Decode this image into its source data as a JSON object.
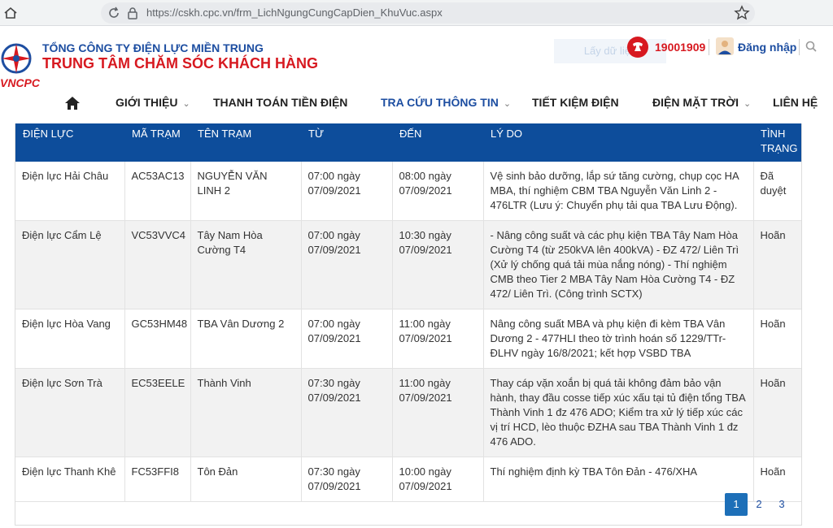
{
  "browser": {
    "url": "https://cskh.cpc.vn/frm_LichNgungCungCapDien_KhuVuc.aspx",
    "icons": [
      "home-icon",
      "reload-icon",
      "lock-icon",
      "star-icon"
    ]
  },
  "header": {
    "company": "TỔNG CÔNG TY ĐIỆN LỰC MIỀN TRUNG",
    "center": "TRUNG TÂM CHĂM SÓC KHÁCH HÀNG",
    "logo_text": "VNCPC",
    "faint_button": "Lấy dữ liệu",
    "hotline": "19001909",
    "login": "Đăng nhập",
    "colors": {
      "brand_blue": "#1d4ea1",
      "brand_red": "#d71920"
    }
  },
  "nav": {
    "items": [
      {
        "label": "GIỚI THIỆU",
        "has_dropdown": true
      },
      {
        "label": "THANH TOÁN TIỀN ĐIỆN",
        "has_dropdown": false
      },
      {
        "label": "TRA CỨU THÔNG TIN",
        "has_dropdown": true
      },
      {
        "label": "TIẾT KIỆM ĐIỆN",
        "has_dropdown": false
      },
      {
        "label": "ĐIỆN MẶT TRỜI",
        "has_dropdown": true
      },
      {
        "label": "LIÊN HỆ",
        "has_dropdown": false
      }
    ],
    "active_index": 2,
    "chevron": "⌄"
  },
  "table": {
    "header_color": "#0d4d9b",
    "columns": [
      "ĐIỆN LỰC",
      "MÃ TRẠM",
      "TÊN TRẠM",
      "TỪ",
      "ĐẾN",
      "LÝ DO",
      "TÌNH TRẠNG"
    ],
    "rows": [
      {
        "dien_luc": "Điện lực Hải Châu",
        "ma_tram": "AC53AC13",
        "ten_tram": "NGUYỄN VĂN LINH 2",
        "tu": "07:00 ngày 07/09/2021",
        "den": "08:00 ngày 07/09/2021",
        "ly_do": "Vệ sinh bảo dưỡng, lắp sứ tăng cường, chụp cọc HA MBA, thí nghiệm CBM TBA Nguyễn Văn Linh 2 - 476LTR (Lưu ý: Chuyển phụ tải qua TBA Lưu Động).",
        "tinh_trang": "Đã duyệt"
      },
      {
        "dien_luc": "Điện lực Cẩm Lệ",
        "ma_tram": "VC53VVC4",
        "ten_tram": "Tây Nam Hòa Cường T4",
        "tu": "07:00 ngày 07/09/2021",
        "den": "10:30 ngày 07/09/2021",
        "ly_do": "- Nâng công suất và các phụ kiện TBA Tây Nam Hòa Cường T4 (từ 250kVA lên 400kVA) - ĐZ 472/ Liên Trì (Xử lý chống quá tải mùa nắng nóng) - Thí nghiệm CMB theo Tier 2 MBA Tây Nam Hòa Cường T4 - ĐZ 472/ Liên Trì. (Công trình SCTX)",
        "tinh_trang": "Hoãn"
      },
      {
        "dien_luc": "Điện lực Hòa Vang",
        "ma_tram": "GC53HM48",
        "ten_tram": "TBA Vân Dương 2",
        "tu": "07:00 ngày 07/09/2021",
        "den": "11:00 ngày 07/09/2021",
        "ly_do": "Nâng công suất MBA và phụ kiện đi kèm TBA Vân Dương 2 - 477HLI theo tờ trình hoán số 1229/TTr-ĐLHV ngày 16/8/2021; kết hợp VSBD TBA",
        "tinh_trang": "Hoãn"
      },
      {
        "dien_luc": "Điện lực Sơn Trà",
        "ma_tram": "EC53EELE",
        "ten_tram": "Thành Vinh",
        "tu": "07:30 ngày 07/09/2021",
        "den": "11:00 ngày 07/09/2021",
        "ly_do": "Thay cáp vặn xoắn bị quá tải không đảm bảo vận hành, thay đầu cosse tiếp xúc xấu tại tủ điện tổng TBA Thành Vinh 1 đz 476 ADO; Kiểm tra xử lý tiếp xúc các vị trí HCD, lèo thuộc ĐZHA sau TBA Thành Vinh 1 đz 476 ADO.",
        "tinh_trang": "Hoãn"
      },
      {
        "dien_luc": "Điện lực Thanh Khê",
        "ma_tram": "FC53FFI8",
        "ten_tram": "Tôn Đản",
        "tu": "07:30 ngày 07/09/2021",
        "den": "10:00 ngày 07/09/2021",
        "ly_do": "Thí nghiệm định kỳ TBA Tôn Đản - 476/XHA",
        "tinh_trang": "Hoãn"
      }
    ]
  },
  "pagination": {
    "pages": [
      "1",
      "2",
      "3"
    ],
    "active": "1"
  }
}
